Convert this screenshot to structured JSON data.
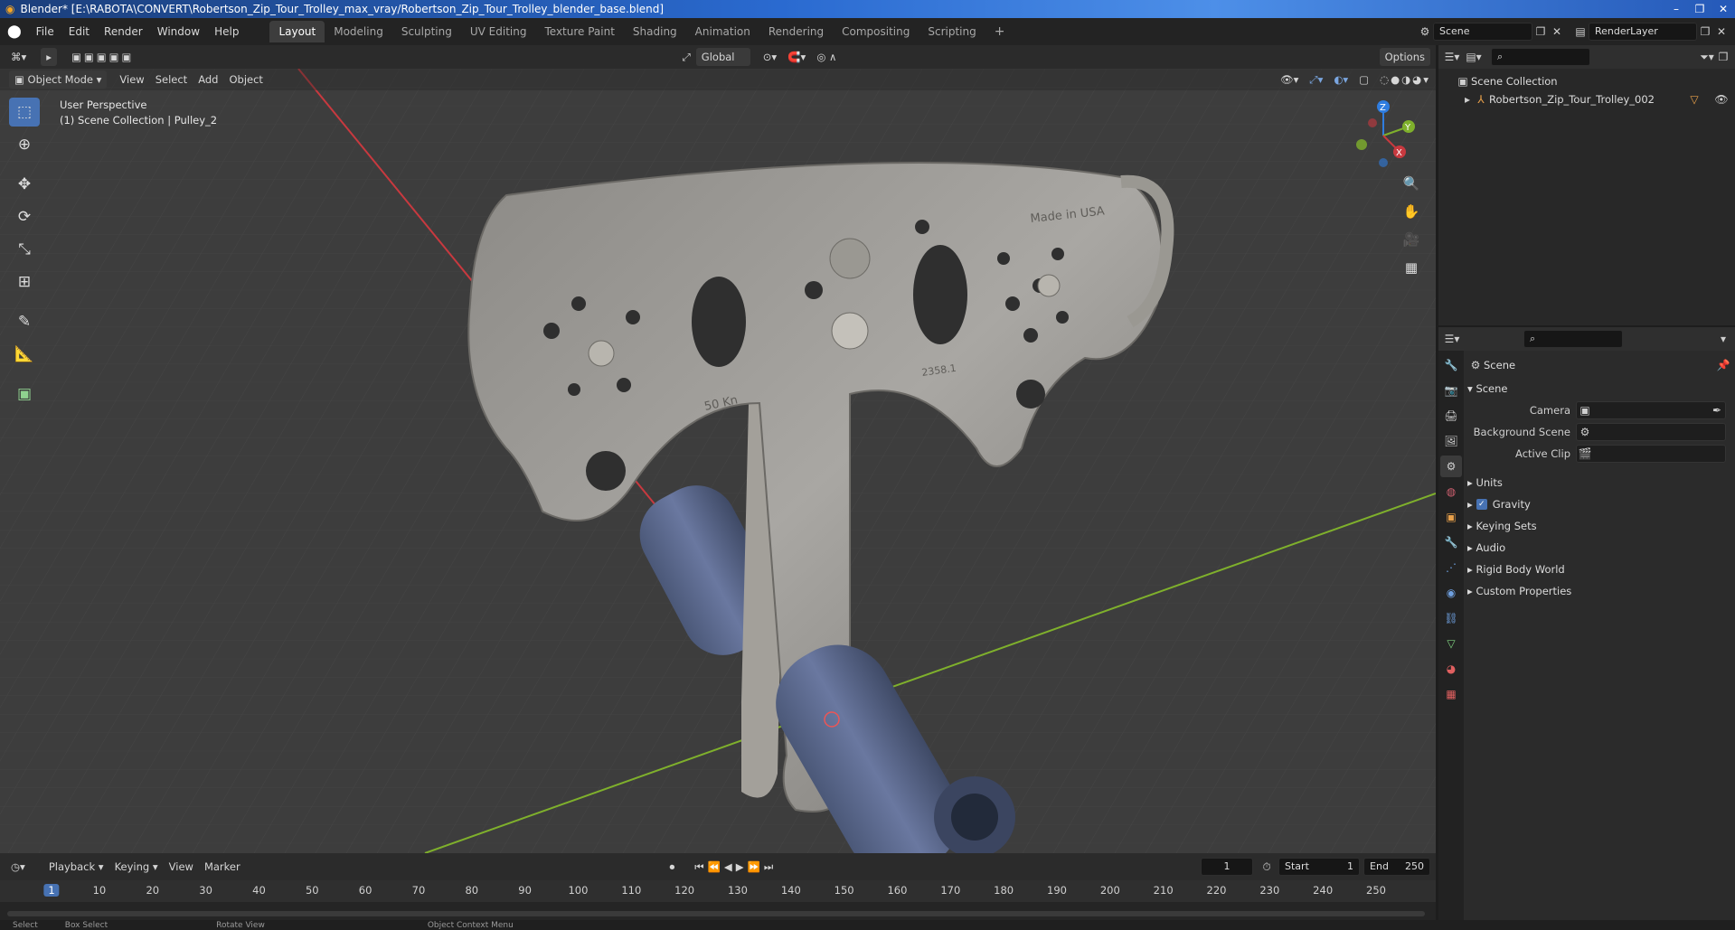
{
  "window": {
    "title": "Blender* [E:\\RABOTA\\CONVERT\\Robertson_Zip_Tour_Trolley_max_vray/Robertson_Zip_Tour_Trolley_blender_base.blend]"
  },
  "menu": {
    "items": [
      "File",
      "Edit",
      "Render",
      "Window",
      "Help"
    ],
    "workspaces": [
      "Layout",
      "Modeling",
      "Sculpting",
      "UV Editing",
      "Texture Paint",
      "Shading",
      "Animation",
      "Rendering",
      "Compositing",
      "Scripting"
    ],
    "active_workspace": "Layout",
    "scene_name": "Scene",
    "view_layer": "RenderLayer"
  },
  "viewport_header": {
    "transform_orientation": "Global",
    "options_label": "Options",
    "mode": "Object Mode",
    "menus": [
      "View",
      "Select",
      "Add",
      "Object"
    ]
  },
  "viewport": {
    "perspective_label": "User Perspective",
    "collection_label": "(1) Scene Collection | Pulley_2",
    "model_text_1": "Made in USA",
    "model_text_2": "50 Kn",
    "model_text_3": "2358.1",
    "gizmo": {
      "x": "X",
      "y": "Y",
      "z": "Z"
    }
  },
  "outliner": {
    "root": "Scene Collection",
    "items": [
      "Robertson_Zip_Tour_Trolley_002"
    ]
  },
  "properties": {
    "context": "Scene",
    "panel_title": "Scene",
    "fields": [
      {
        "label": "Camera"
      },
      {
        "label": "Background Scene"
      },
      {
        "label": "Active Clip"
      }
    ],
    "panels": [
      "Units",
      "Gravity",
      "Keying Sets",
      "Audio",
      "Rigid Body World",
      "Custom Properties"
    ],
    "gravity_checked": true
  },
  "timeline": {
    "menus": [
      "Playback",
      "Keying",
      "View",
      "Marker"
    ],
    "current_frame": "1",
    "start_label": "Start",
    "start": "1",
    "end_label": "End",
    "end": "250",
    "ticks": [
      "1",
      "10",
      "20",
      "30",
      "40",
      "50",
      "60",
      "70",
      "80",
      "90",
      "100",
      "110",
      "120",
      "130",
      "140",
      "150",
      "160",
      "170",
      "180",
      "190",
      "200",
      "210",
      "220",
      "230",
      "240",
      "250"
    ]
  },
  "status": {
    "items": [
      "Select",
      "Box Select",
      "Rotate View",
      "Object Context Menu"
    ]
  },
  "colors": {
    "accent": "#4772b3",
    "x_axis": "#c8393f",
    "y_axis": "#7fb02c",
    "z_axis": "#2f7de0"
  }
}
